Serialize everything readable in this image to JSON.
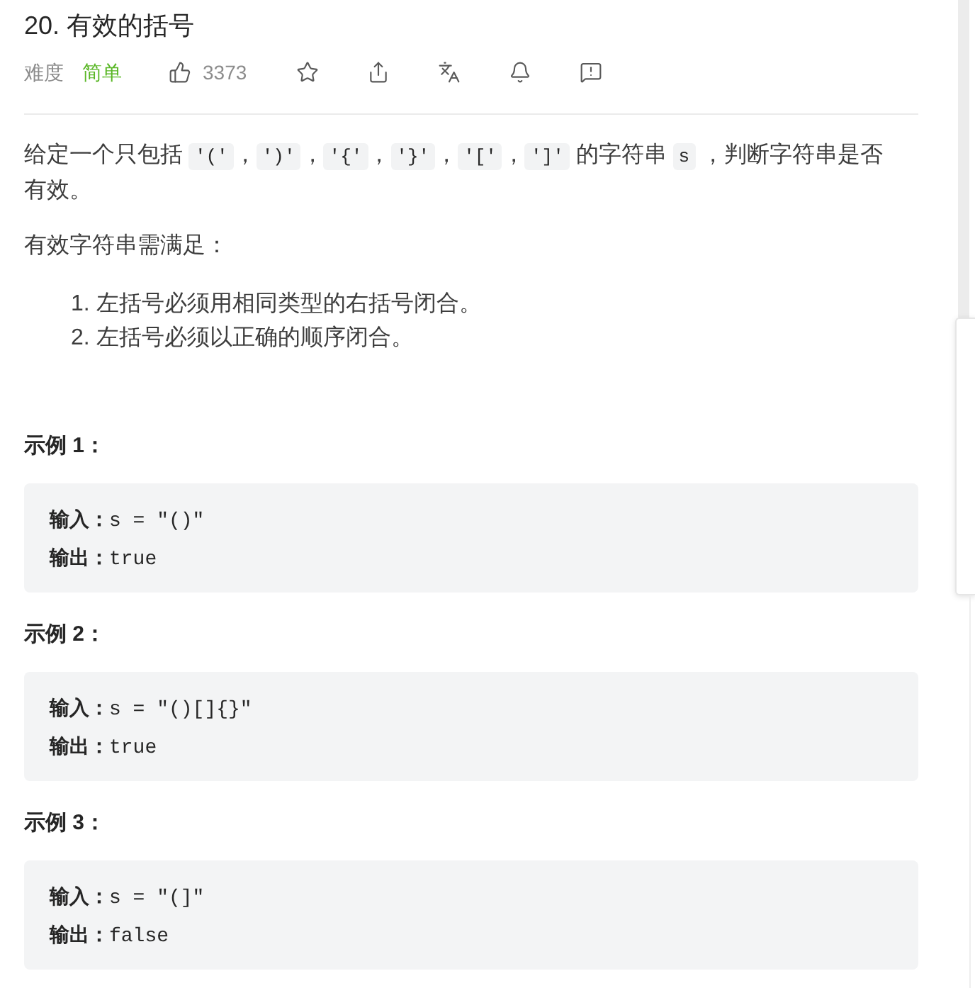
{
  "title": "20. 有效的括号",
  "meta": {
    "difficulty_label": "难度",
    "difficulty": "简单",
    "likes": "3373"
  },
  "description": {
    "segments": [
      {
        "kind": "text",
        "text": "给定一个只包括 "
      },
      {
        "kind": "code",
        "text": "'('"
      },
      {
        "kind": "text",
        "text": "，"
      },
      {
        "kind": "code",
        "text": "')'"
      },
      {
        "kind": "text",
        "text": "，"
      },
      {
        "kind": "code",
        "text": "'{'"
      },
      {
        "kind": "text",
        "text": "，"
      },
      {
        "kind": "code",
        "text": "'}'"
      },
      {
        "kind": "text",
        "text": "，"
      },
      {
        "kind": "code",
        "text": "'['"
      },
      {
        "kind": "text",
        "text": "，"
      },
      {
        "kind": "code",
        "text": "']'"
      },
      {
        "kind": "text",
        "text": " 的字符串 "
      },
      {
        "kind": "code",
        "text": "s"
      },
      {
        "kind": "text",
        "text": " ，判断字符串是否有效。"
      }
    ]
  },
  "requirements_intro": "有效字符串需满足：",
  "requirements": [
    {
      "number": "1.",
      "text": "左括号必须用相同类型的右括号闭合。"
    },
    {
      "number": "2.",
      "text": "左括号必须以正确的顺序闭合。"
    }
  ],
  "examples": [
    {
      "title": "示例 1：",
      "lines": [
        {
          "label": "输入：",
          "value": "s = \"()\""
        },
        {
          "label": "输出：",
          "value": "true"
        }
      ]
    },
    {
      "title": "示例 2：",
      "lines": [
        {
          "label": "输入：",
          "value": "s = \"()[]{}\""
        },
        {
          "label": "输出：",
          "value": "true"
        }
      ]
    },
    {
      "title": "示例 3：",
      "lines": [
        {
          "label": "输入：",
          "value": "s = \"(]\""
        },
        {
          "label": "输出：",
          "value": "false"
        }
      ]
    }
  ]
}
